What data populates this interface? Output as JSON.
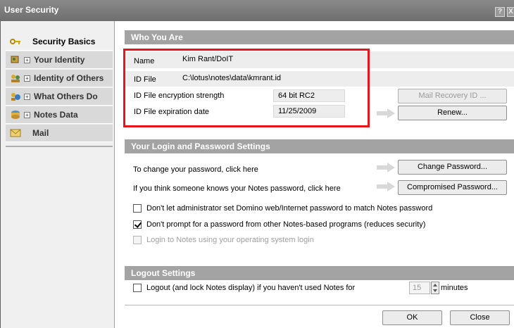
{
  "window": {
    "title": "User Security",
    "help_button": "?",
    "close_button": "X"
  },
  "sidebar": {
    "items": [
      {
        "label": "Security Basics",
        "icon": "key-icon",
        "expander": ""
      },
      {
        "label": "Your Identity",
        "icon": "identity-card-icon",
        "expander": "+"
      },
      {
        "label": "Identity of Others",
        "icon": "people-icon",
        "expander": "+"
      },
      {
        "label": "What Others Do",
        "icon": "people-gear-icon",
        "expander": "+"
      },
      {
        "label": "Notes Data",
        "icon": "data-icon",
        "expander": "+"
      },
      {
        "label": "Mail",
        "icon": "envelope-icon",
        "expander": ""
      }
    ]
  },
  "who_you_are": {
    "header": "Who You Are",
    "name_label": "Name",
    "name_value": "Kim Rant/DoIT",
    "id_file_label": "ID File",
    "id_file_value": "C:\\lotus\\notes\\data\\kmrant.id",
    "encryption_label": "ID File encryption strength",
    "encryption_value": "64 bit RC2",
    "expiration_label": "ID File expiration date",
    "expiration_value": "11/25/2009",
    "mail_recovery_button": "Mail Recovery ID ...",
    "renew_button": "Renew..."
  },
  "login": {
    "header": "Your Login and Password Settings",
    "change_password_text": "To change your password, click here",
    "change_password_button": "Change Password...",
    "compromised_text": "If you think someone knows your Notes password, click here",
    "compromised_button": "Compromised Password...",
    "options": [
      {
        "label": "Don't let administrator set Domino web/Internet password to match Notes password",
        "checked": false,
        "disabled": false
      },
      {
        "label": "Don't prompt for a password from other Notes-based programs (reduces security)",
        "checked": true,
        "disabled": false
      },
      {
        "label": "Login to Notes using your operating system login",
        "checked": false,
        "disabled": true
      }
    ]
  },
  "logout": {
    "header": "Logout Settings",
    "label": "Logout (and lock Notes display) if you haven't used Notes for",
    "minutes_value": "15",
    "minutes_label": "minutes",
    "checked": false
  },
  "footer": {
    "ok_button": "OK",
    "close_button": "Close"
  },
  "colors": {
    "highlight_border": "#e8141c",
    "section_header": "#a3a3a3",
    "arrow": "#d8d8d8"
  }
}
